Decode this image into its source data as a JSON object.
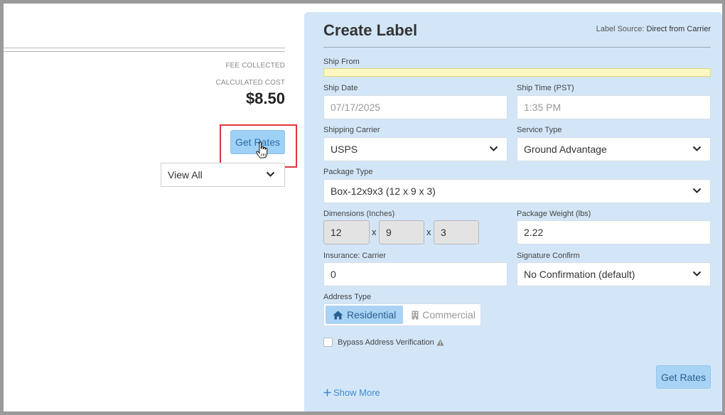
{
  "left_panel": {
    "fee_collected_label": "FEE COLLECTED",
    "calculated_cost_label": "CALCULATED COST",
    "calculated_cost_value": "$8.50",
    "get_rates_label": "Get Rates",
    "view_select_value": "View All"
  },
  "create_label": {
    "title": "Create Label",
    "label_source_label": "Label Source:",
    "label_source_value": "Direct from Carrier",
    "ship_from_label": "Ship From",
    "ship_date_label": "Ship Date",
    "ship_date_value": "07/17/2025",
    "ship_time_label": "Ship Time (PST)",
    "ship_time_value": "1:35 PM",
    "shipping_carrier_label": "Shipping Carrier",
    "shipping_carrier_value": "USPS",
    "service_type_label": "Service Type",
    "service_type_value": "Ground Advantage",
    "package_type_label": "Package Type",
    "package_type_value": "Box-12x9x3 (12 x 9 x 3)",
    "dimensions_label": "Dimensions (Inches)",
    "dim_length": "12",
    "dim_width": "9",
    "dim_height": "3",
    "dim_separator": "x",
    "package_weight_label": "Package Weight (lbs)",
    "package_weight_value": "2.22",
    "insurance_label": "Insurance: Carrier",
    "insurance_value": "0",
    "signature_label": "Signature Confirm",
    "signature_value": "No Confirmation (default)",
    "address_type_label": "Address Type",
    "address_residential": "Residential",
    "address_commercial": "Commercial",
    "bypass_label": "Bypass Address Verification",
    "get_rates_label": "Get Rates",
    "show_more_label": "Show More"
  },
  "colors": {
    "panel_bg": "#d3e6f8",
    "button_bg": "#a9d3f5",
    "highlight_border": "#e0363a",
    "link": "#3b8ad4"
  }
}
